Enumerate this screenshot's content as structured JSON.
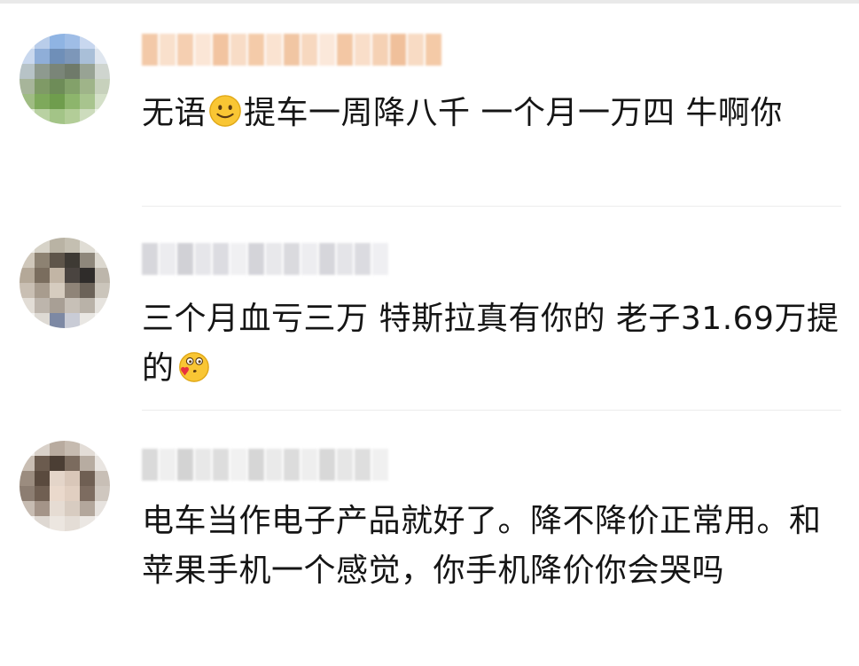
{
  "comments": [
    {
      "text_before_emoji": "无语",
      "emoji": "smile-emoji",
      "text_after_emoji": "提车一周降八千 一个月一万四 牛啊你"
    },
    {
      "text_before_emoji": "三个月血亏三万 特斯拉真有你的 老子31.69万提的",
      "emoji": "kiss-heart-emoji",
      "text_after_emoji": ""
    },
    {
      "text_before_emoji": "电车当作电子产品就好了。降不降价正常用。和苹果手机一个感觉，你手机降价你会哭吗",
      "emoji": "",
      "text_after_emoji": ""
    }
  ],
  "colors": {
    "text": "#151515",
    "divider": "#ececec",
    "name1": "#f6c9a6",
    "name2": "#d9d9de",
    "name3": "#dcdcdc"
  }
}
